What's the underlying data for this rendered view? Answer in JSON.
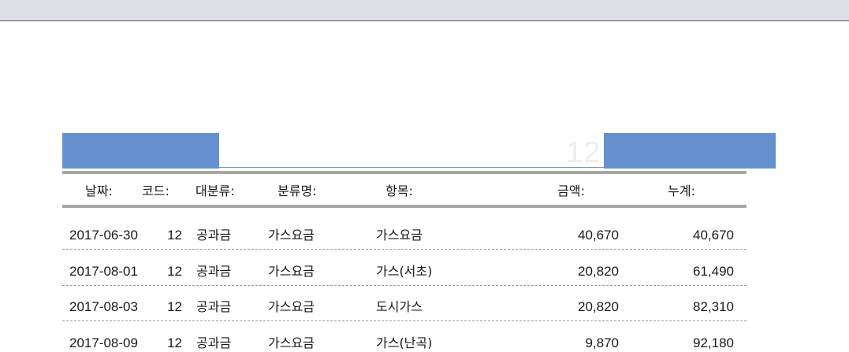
{
  "header_band": {
    "ghost_number": "12"
  },
  "columns": {
    "date": "날짜:",
    "code": "코드:",
    "major_category": "대분류:",
    "category_name": "분류명:",
    "item": "항목:",
    "amount": "금액:",
    "cumulative": "누계:"
  },
  "rows": [
    {
      "date": "2017-06-30",
      "code": "12",
      "major_category": "공과금",
      "category_name": "가스요금",
      "item": "가스요금",
      "amount": "40,670",
      "cumulative": "40,670"
    },
    {
      "date": "2017-08-01",
      "code": "12",
      "major_category": "공과금",
      "category_name": "가스요금",
      "item": "가스(서초)",
      "amount": "20,820",
      "cumulative": "61,490"
    },
    {
      "date": "2017-08-03",
      "code": "12",
      "major_category": "공과금",
      "category_name": "가스요금",
      "item": "도시가스",
      "amount": "20,820",
      "cumulative": "82,310"
    },
    {
      "date": "2017-08-09",
      "code": "12",
      "major_category": "공과금",
      "category_name": "가스요금",
      "item": "가스(난곡)",
      "amount": "9,870",
      "cumulative": "92,180"
    }
  ]
}
